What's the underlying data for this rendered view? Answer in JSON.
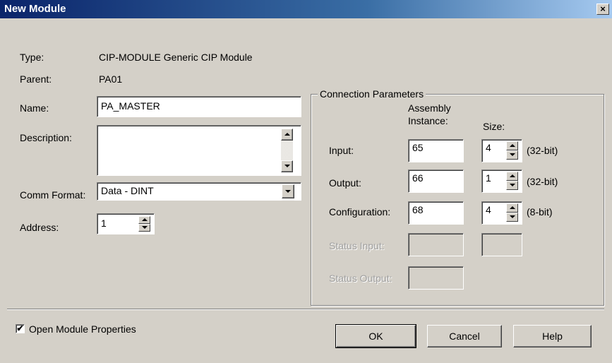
{
  "window": {
    "title": "New Module",
    "close_glyph": "×"
  },
  "info": {
    "type_label": "Type:",
    "type_value": "CIP-MODULE Generic CIP Module",
    "parent_label": "Parent:",
    "parent_value": "PA01"
  },
  "name": {
    "label": "Name:",
    "value": "PA_MASTER"
  },
  "description": {
    "label": "Description:",
    "value": ""
  },
  "comm_format": {
    "label": "Comm Format:",
    "value": "Data - DINT"
  },
  "address": {
    "label": "Address:",
    "value": "1"
  },
  "connection": {
    "title": "Connection Parameters",
    "col_assembly_line1": "Assembly",
    "col_assembly_line2": "Instance:",
    "col_size": "Size:",
    "rows": [
      {
        "label": "Input:",
        "instance": "65",
        "size": "4",
        "unit": "(32-bit)"
      },
      {
        "label": "Output:",
        "instance": "66",
        "size": "1",
        "unit": "(32-bit)"
      },
      {
        "label": "Configuration:",
        "instance": "68",
        "size": "4",
        "unit": "(8-bit)"
      },
      {
        "label": "Status Input:",
        "instance": "",
        "size": ""
      },
      {
        "label": "Status Output:",
        "instance": ""
      }
    ]
  },
  "footer": {
    "open_props_label": "Open Module Properties",
    "open_props_checked": true,
    "check_glyph": "✔",
    "ok": "OK",
    "cancel": "Cancel",
    "help": "Help"
  },
  "colors": {
    "dialog_bg": "#d4d0c8",
    "title_start": "#0a246a",
    "title_end": "#a6caf0"
  }
}
